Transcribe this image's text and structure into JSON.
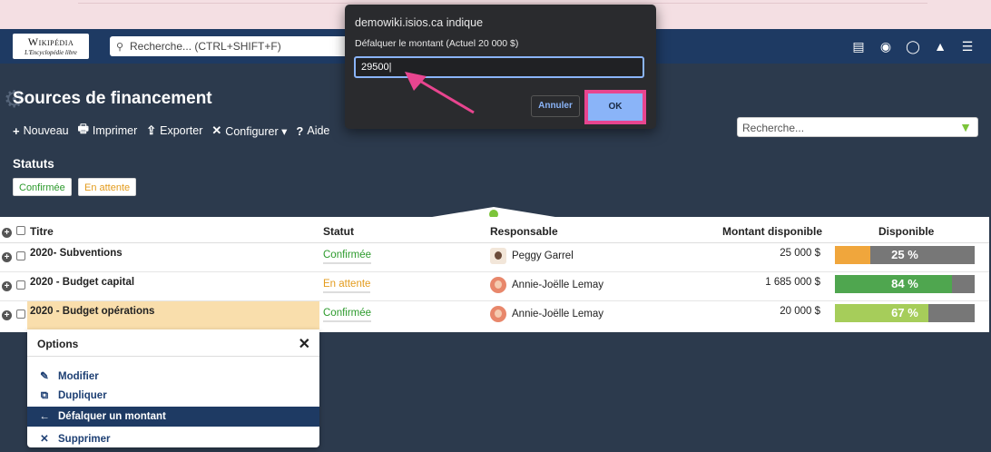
{
  "browser": {
    "dialog": {
      "origin": "demowiki.isios.ca indique",
      "message": "Défalquer le montant (Actuel 20 000 $)",
      "input_value": "29500",
      "cancel_label": "Annuler",
      "ok_label": "OK"
    }
  },
  "navbar": {
    "logo_main": "Wikipédia",
    "logo_sub": "L'Encyclopédie libre",
    "search_placeholder": "Recherche... (CTRL+SHIFT+F)"
  },
  "page": {
    "title": "Sources de financement",
    "toolbar": [
      {
        "icon": "+",
        "label": "Nouveau"
      },
      {
        "icon": "🖶",
        "label": "Imprimer"
      },
      {
        "icon": "⇪",
        "label": "Exporter"
      },
      {
        "icon": "✕",
        "label": "Configurer ▾"
      },
      {
        "icon": "?",
        "label": "Aide"
      }
    ],
    "search_placeholder": "Recherche..."
  },
  "statuts": {
    "title": "Statuts",
    "confirmed": "Confirmée",
    "pending": "En attente"
  },
  "table": {
    "headers": {
      "titre": "Titre",
      "statut": "Statut",
      "responsable": "Responsable",
      "montant": "Montant disponible",
      "disponible": "Disponible"
    },
    "rows": [
      {
        "titre": "2020- Subventions",
        "statut": "Confirmée",
        "responsable": "Peggy Garrel",
        "montant": "25 000 $",
        "pct_label": "25 %",
        "pct": 25,
        "color": "#f0a63c"
      },
      {
        "titre": "2020 - Budget capital",
        "statut": "En attente",
        "responsable": "Annie-Joëlle Lemay",
        "montant": "1 685 000 $",
        "pct_label": "84 %",
        "pct": 84,
        "color": "#4fa64f"
      },
      {
        "titre": "2020 - Budget opérations",
        "statut": "Confirmée",
        "responsable": "Annie-Joëlle Lemay",
        "montant": "20 000 $",
        "pct_label": "67 %",
        "pct": 67,
        "color": "#a6cd5a"
      }
    ]
  },
  "options": {
    "title": "Options",
    "items": [
      {
        "icon": "✎",
        "label": "Modifier"
      },
      {
        "icon": "⧉",
        "label": "Dupliquer"
      },
      {
        "icon": "←",
        "label": "Défalquer un montant"
      },
      {
        "icon": "✕",
        "label": "Supprimer"
      }
    ]
  },
  "colors": {
    "navbar": "#1e3a63",
    "background": "#2c3a4d",
    "annotation": "#e8458f"
  }
}
